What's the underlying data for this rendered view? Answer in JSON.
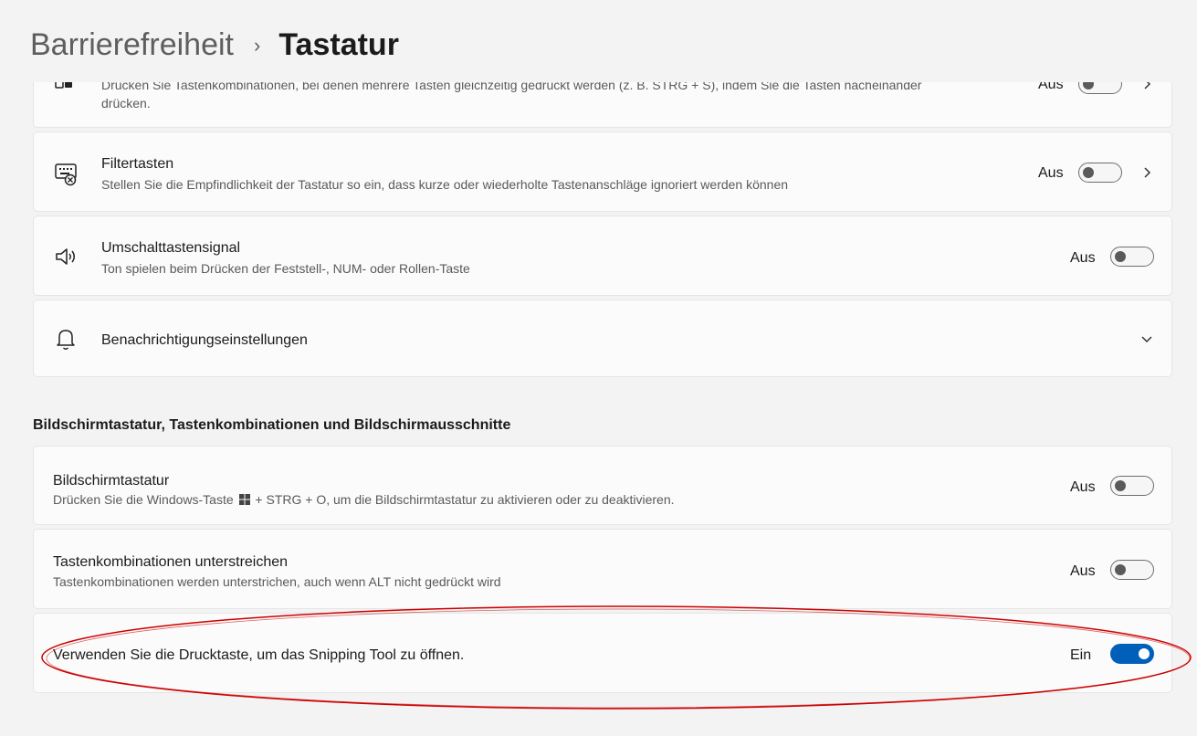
{
  "breadcrumb": {
    "parent": "Barrierefreiheit",
    "separator": "›",
    "current": "Tastatur"
  },
  "cards": {
    "einrastfunktion": {
      "desc_line1": "Drücken Sie Tastenkombinationen, bei denen mehrere Tasten gleichzeitig gedrückt werden (z. B. STRG + S), indem Sie die Tasten nacheinander",
      "desc_line2": "drücken.",
      "state": "Aus"
    },
    "filtertasten": {
      "title": "Filtertasten",
      "desc": "Stellen Sie die Empfindlichkeit der Tastatur so ein, dass kurze oder wiederholte Tastenanschläge ignoriert werden können",
      "state": "Aus"
    },
    "umschalttastensignal": {
      "title": "Umschalttastensignal",
      "desc": "Ton spielen beim Drücken der Feststell-, NUM- oder Rollen-Taste",
      "state": "Aus"
    },
    "benachrichtigung": {
      "title": "Benachrichtigungseinstellungen"
    }
  },
  "section": {
    "heading": "Bildschirmtastatur, Tastenkombinationen und Bildschirmausschnitte",
    "bildschirmtastatur": {
      "title": "Bildschirmtastatur",
      "desc_before": "Drücken Sie die Windows-Taste",
      "desc_after": "+ STRG + O, um die Bildschirmtastatur zu aktivieren oder zu deaktivieren.",
      "state": "Aus"
    },
    "unterstreichen": {
      "title": "Tastenkombinationen unterstreichen",
      "desc": "Tastenkombinationen werden unterstrichen, auch wenn ALT nicht gedrückt wird",
      "state": "Aus"
    },
    "drucktaste": {
      "title": "Verwenden Sie die Drucktaste, um das Snipping Tool zu öffnen.",
      "state": "Ein"
    }
  },
  "colors": {
    "accent": "#005fb8",
    "annotation": "#cc0000"
  }
}
